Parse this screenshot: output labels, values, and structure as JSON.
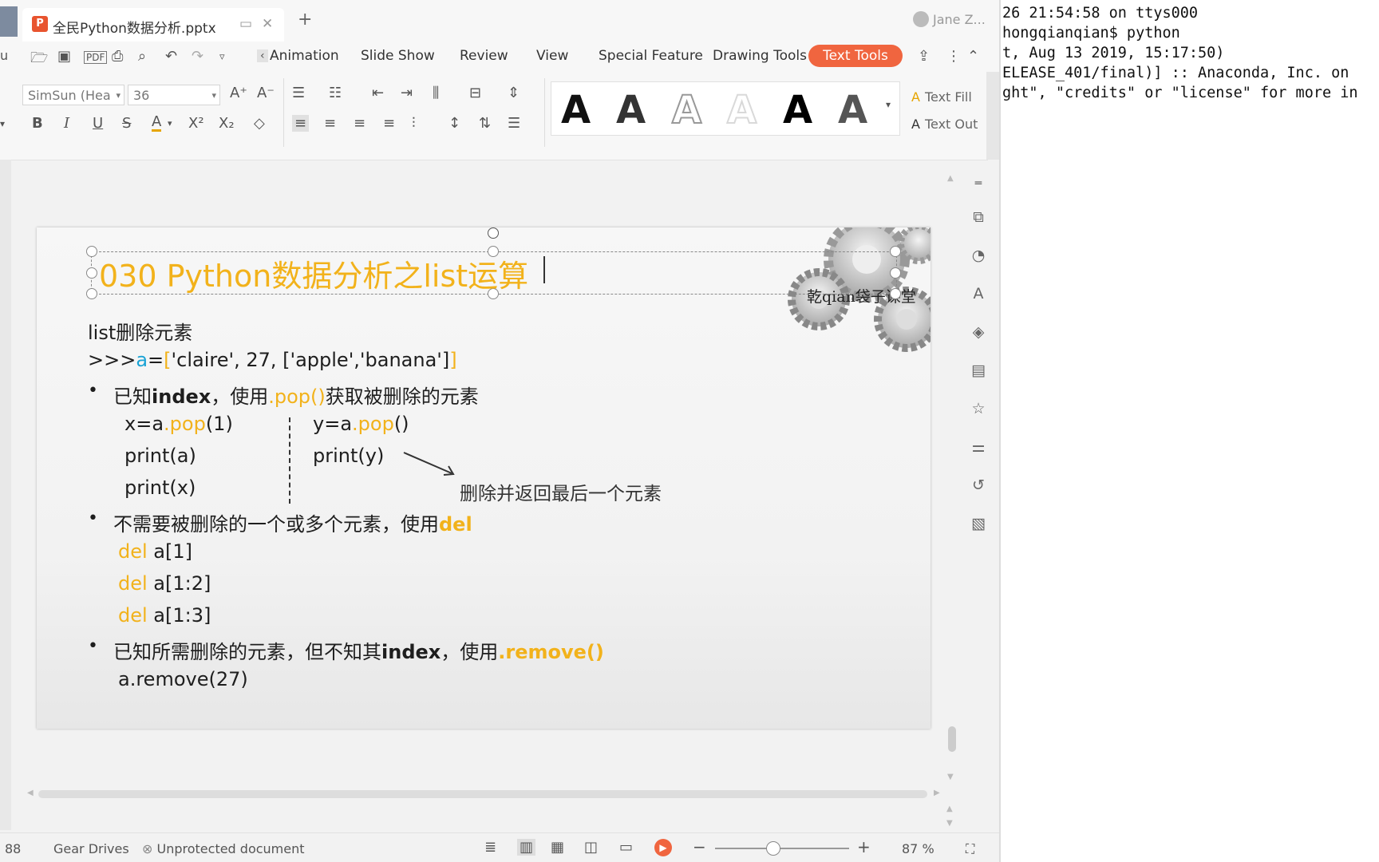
{
  "window": {
    "tab_title": "全民Python数据分析.pptx",
    "new_tab": "+",
    "user": "Jane Z..."
  },
  "menu": {
    "left_cut": "u",
    "items": [
      "Animation",
      "Slide Show",
      "Review",
      "View",
      "Special Feature",
      "Drawing Tools",
      "Text Tools"
    ],
    "active": "Text Tools"
  },
  "ribbon": {
    "font_name": "SimSun (Hea",
    "font_size": "36",
    "wordart_colors": [
      "#111111",
      "#333333",
      "#999999",
      "#d9d9d9",
      "#000000",
      "#555555"
    ],
    "text_fill": "Text Fill",
    "text_outline": "Text Out"
  },
  "slide": {
    "title": "030 Python数据分析之list运算",
    "watermark": "乾qian袋子课堂",
    "subtitle": "list删除元素",
    "line_a_prefix": ">>>",
    "line_a_var": "a",
    "line_a_eq": "=",
    "line_a_lb": "[",
    "line_a_body": "'claire', 27, ['apple','banana']",
    "line_a_rb": "]",
    "bullet1_a": "已知",
    "bullet1_b": "index",
    "bullet1_c": "，使用",
    "bullet1_d": ".pop()",
    "bullet1_e": "获取被删除的元素",
    "code_l1_a": "x=a",
    "code_l1_b": ".pop",
    "code_l1_c": "(1)",
    "code_l2": "print(a)",
    "code_l3": "print(x)",
    "code_r1_a": "y=a",
    "code_r1_b": ".pop",
    "code_r1_c": "()",
    "code_r2": "print(y)",
    "annotation": "删除并返回最后一个元素",
    "bullet2_a": "不需要被删除的一个或多个元素，使用",
    "bullet2_b": "del",
    "del_kw": "del",
    "del_1": " a[1]",
    "del_2": " a[1:2]",
    "del_3": " a[1:3]",
    "bullet3_a": "已知所需删除的元素，但不知其",
    "bullet3_b": "index",
    "bullet3_c": "，使用",
    "bullet3_d": ".remove()",
    "remove_line": "a.remove(27)",
    "bullet_char": "•"
  },
  "status": {
    "slide_num": "88",
    "theme": "Gear Drives",
    "protection": "Unprotected document",
    "zoom": "87 %"
  },
  "terminal": {
    "lines": [
      "26 21:54:58 on ttys000",
      "hongqianqian$ python",
      "t, Aug 13 2019, 15:17:50)",
      "ELEASE_401/final)] :: Anaconda, Inc. on",
      "ght\", \"credits\" or \"license\" for more in"
    ]
  }
}
